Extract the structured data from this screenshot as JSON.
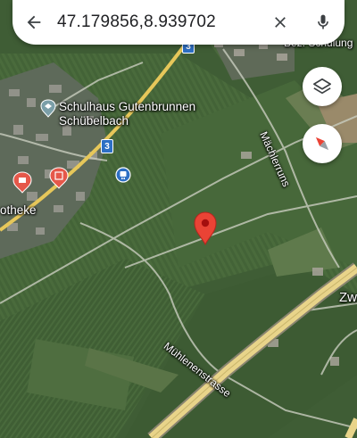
{
  "search": {
    "query": "47.179856,8.939702"
  },
  "icons": {
    "back": "arrow-left-icon",
    "clear": "close-icon",
    "voice": "microphone-icon",
    "layers": "layers-icon",
    "compass": "compass-icon",
    "dropped_pin": "red-location-pin-icon"
  },
  "map": {
    "labels": {
      "school_line1": "Schulhaus Gutenbrunnen",
      "school_line2": "Schübelbach",
      "pharmacy": "otheke",
      "street_top_right": "Bez. Schulung",
      "street_muehlenstrasse": "Mühlenenstrasse",
      "street_machler": "Mächlerruns",
      "zw": "Zw"
    },
    "route_number": "3",
    "route_number_top": "3"
  },
  "colors": {
    "pin_red": "#ea4335",
    "highway": "#e8d48a",
    "accent_blue": "#1a73e8"
  }
}
